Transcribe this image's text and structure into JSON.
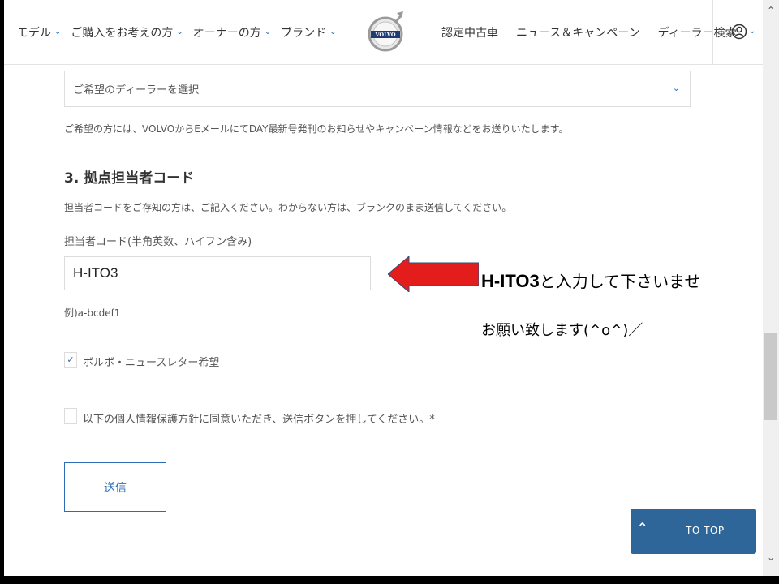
{
  "header": {
    "nav_left": [
      {
        "label": "モデル"
      },
      {
        "label": "ご購入をお考えの方"
      },
      {
        "label": "オーナーの方"
      },
      {
        "label": "ブランド"
      }
    ],
    "logo_text": "VOLVO",
    "nav_right": [
      {
        "label": "認定中古車"
      },
      {
        "label": "ニュース＆キャンペーン"
      },
      {
        "label": "ディーラー検索"
      }
    ],
    "account_icon": "user-icon"
  },
  "form": {
    "dealer_select_value": "ご希望のディーラーを選択",
    "dealer_note": "ご希望の方には、VOLVOからEメールにてDAY最新号発刊のお知らせやキャンペーン情報などをお送りいたします。",
    "section_title": "3. 拠点担当者コード",
    "section_desc": "担当者コードをご存知の方は、ご記入ください。わからない方は、ブランクのまま送信してください。",
    "code_label": "担当者コード(半角英数、ハイフン含み)",
    "code_value": "H-ITO3",
    "code_example": "例)a-bcdef1",
    "newsletter_label": "ボルボ・ニュースレター希望",
    "newsletter_checked": true,
    "privacy_label": "以下の個人情報保護方針に同意いただき、送信ボタンを押してください。*",
    "privacy_checked": false,
    "submit_label": "送信"
  },
  "to_top": {
    "label": "TO TOP"
  },
  "annotation": {
    "code": "H-ITO3",
    "line1_suffix": "と入力して下さいませ",
    "line2": "お願い致します(^o^)／",
    "arrow_color": "#e31c1c"
  }
}
